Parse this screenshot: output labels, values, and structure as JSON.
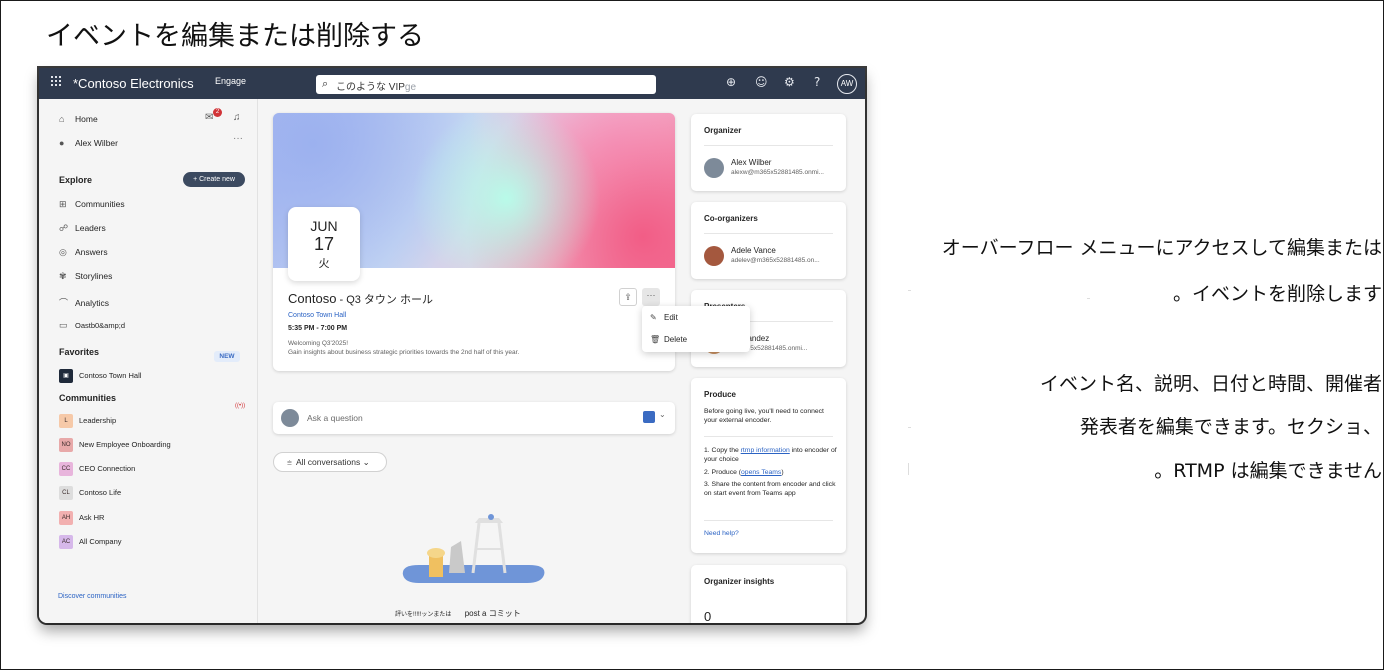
{
  "heading": "イベントを編集または削除する",
  "topbar": {
    "app_name": "*Contoso Electronics",
    "engage": "Engage",
    "search_text": "このような VIP",
    "search_ghost": "ge",
    "avatar_initials": "AW",
    "icons": [
      "waffle-icon",
      "globe-icon",
      "smiley-icon",
      "gear-icon",
      "help-icon"
    ]
  },
  "nav": {
    "home": "Home",
    "user": "Alex Wilber",
    "badge_count": "2",
    "explore_label": "Explore",
    "create_new": "Create new",
    "explore_items": [
      "Communities",
      "Leaders",
      "Answers",
      "Storylines",
      "Analytics",
      "Oastb0&amp;d"
    ],
    "new_badge": "NEW",
    "favorites_label": "Favorites",
    "favorite_item": "Contoso Town Hall",
    "live_indicator": "((•))",
    "communities_label": "Communities",
    "communities": [
      {
        "initials": "L",
        "name": "Leadership",
        "color": "#f6c9a8"
      },
      {
        "initials": "NO",
        "name": "New Employee Onboarding",
        "color": "#e8a9a9"
      },
      {
        "initials": "CC",
        "name": "CEO Connection",
        "color": "#e8b5dc"
      },
      {
        "initials": "CL",
        "name": "Contoso Life",
        "color": "#dddddd"
      },
      {
        "initials": "AH",
        "name": "Ask HR",
        "color": "#f2b0b0"
      },
      {
        "initials": "AC",
        "name": "All Company",
        "color": "#d6b8ea"
      }
    ],
    "discover": "Discover communities"
  },
  "event": {
    "month": "JUN",
    "day": "17",
    "weekday": "火",
    "title_main": "Contoso",
    "title_sub": " - Q3 タウン ホール",
    "community_link": "Contoso Town Hall",
    "time": "5:35 PM - 7:00 PM",
    "desc_line1": "Welcoming Q3'2025!",
    "desc_line2": "Gain insights about business strategic priorities towards the 2nd half of this year.",
    "more_dots": "···"
  },
  "overflow_menu": {
    "edit": "Edit",
    "delete": "Delete"
  },
  "ask": {
    "placeholder": "Ask a question"
  },
  "filter": {
    "label": "All conversations"
  },
  "bottom_text": {
    "left": "評いを!!!!!ッンまたは",
    "right": "post a コミット"
  },
  "right": {
    "organizer_label": "Organizer",
    "organizer_name": "Alex Wilber",
    "organizer_mail": "alexw@m365x52881485.onmi...",
    "coorg_label": "Co-organizers",
    "coorg_name": "Adele Vance",
    "coorg_mail": "adelev@m365x52881485.on...",
    "presenters_label": "Presenters",
    "presenter_name": "Fernandez",
    "presenter_mail": "@m365x52881485.onmi...",
    "produce_label": "Produce",
    "produce_intro": "Before going live, you'll need to connect your external encoder.",
    "step1_a": "1.  Copy the ",
    "step1_link": "rtmp information",
    "step1_b": " into encoder of your choice",
    "step2_a": "2.  Produce (",
    "step2_link": "opens Teams",
    "step2_b": ")",
    "step3": "3.  Share the content from encoder and click on start event from Teams app",
    "need_help": "Need help?",
    "insights_label": "Organizer insights",
    "insights_value": "0"
  },
  "annotation": {
    "line1": "オーバーフロー メニューにアクセスして編集または",
    "line2": "。イベントを削除します",
    "line3": "イベント名、説明、日付と時間、開催者",
    "line4": "発表者を編集できます。セクショ、",
    "line5": "。RTMP は編集できません"
  }
}
